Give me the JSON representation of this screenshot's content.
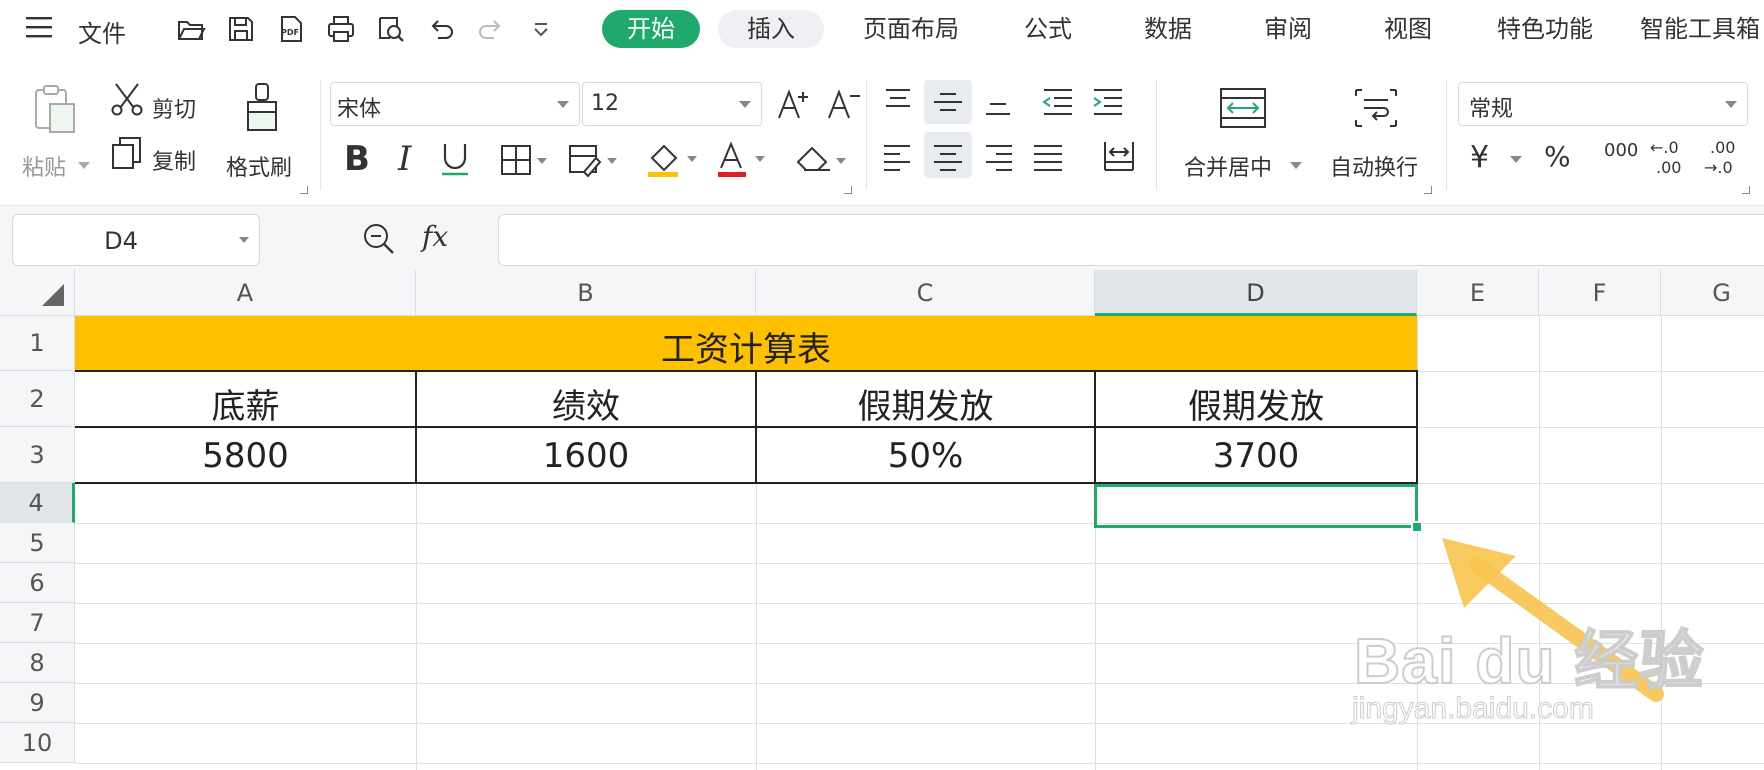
{
  "menubar": {
    "file_label": "文件",
    "tabs": [
      {
        "label": "开始",
        "state": "active"
      },
      {
        "label": "插入",
        "state": "hover"
      },
      {
        "label": "页面布局",
        "state": "normal"
      },
      {
        "label": "公式",
        "state": "normal"
      },
      {
        "label": "数据",
        "state": "normal"
      },
      {
        "label": "审阅",
        "state": "normal"
      },
      {
        "label": "视图",
        "state": "normal"
      },
      {
        "label": "特色功能",
        "state": "normal"
      },
      {
        "label": "智能工具箱",
        "state": "normal"
      }
    ],
    "quick_access_icons": [
      "open-icon",
      "save-icon",
      "export-pdf-icon",
      "print-icon",
      "print-preview-icon",
      "undo-icon",
      "redo-icon",
      "customize-dropdown-icon"
    ]
  },
  "ribbon": {
    "paste_label": "粘贴",
    "cut_label": "剪切",
    "copy_label": "复制",
    "format_painter_label": "格式刷",
    "font_name": "宋体",
    "font_size": "12",
    "merge_center_label": "合并居中",
    "wrap_text_label": "自动换行",
    "number_format": "常规",
    "currency_symbol": "¥",
    "percent_symbol": "%",
    "thousands_symbol": "000",
    "increase_decimal_top": "←.0",
    "increase_decimal_bottom": ".00",
    "decrease_decimal_top": ".00",
    "decrease_decimal_bottom": "→.0",
    "fill_color": "#ffc000",
    "font_color": "#e02020"
  },
  "formula_bar": {
    "cell_ref": "D4",
    "fx_label": "fx",
    "formula_value": ""
  },
  "sheet": {
    "columns": [
      "A",
      "B",
      "C",
      "D",
      "E",
      "F",
      "G"
    ],
    "rows": [
      "1",
      "2",
      "3",
      "4",
      "5",
      "6",
      "7",
      "8",
      "9",
      "10"
    ],
    "selected_column": "D",
    "selected_row": "4",
    "title": "工资计算表",
    "title_fill": "#ffc000",
    "header_row": [
      "底薪",
      "绩效",
      "假期发放",
      "假期发放"
    ],
    "value_row": [
      "5800",
      "1600",
      "50%",
      "3700"
    ],
    "accent_color": "#1faa6b"
  },
  "watermark": {
    "brand": "Bai du 经验",
    "url": "jingyan.baidu.com"
  }
}
